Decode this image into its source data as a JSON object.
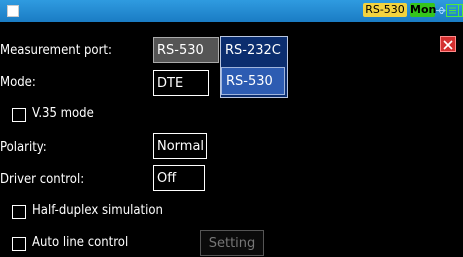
{
  "status_bar": {
    "port_badge": "RS-530",
    "mon_badge": "Mon"
  },
  "form": {
    "measurement_port_label": "Measurement port:",
    "measurement_port_value": "RS-530",
    "mode_label": "Mode:",
    "mode_value": "DTE",
    "v35_label": "V.35 mode",
    "polarity_label": "Polarity:",
    "polarity_value": "Normal",
    "driver_label": "Driver control:",
    "driver_value": "Off",
    "half_duplex_label": "Half-duplex simulation",
    "auto_line_label": "Auto line control",
    "setting_button": "Setting"
  },
  "dropdown": {
    "options": [
      "RS-232C",
      "RS-530"
    ],
    "selected": "RS-530"
  },
  "colors": {
    "topbar": "#1a7cc4",
    "port_badge": "#f3d33f",
    "mon_badge": "#35c51c",
    "close": "#d32f2f",
    "dropdown_bg": "#0b2d6e",
    "dropdown_selected": "#2d5cb2"
  },
  "icons": [
    "usb-icon",
    "network-icon",
    "sd-card-icon",
    "close-icon"
  ]
}
